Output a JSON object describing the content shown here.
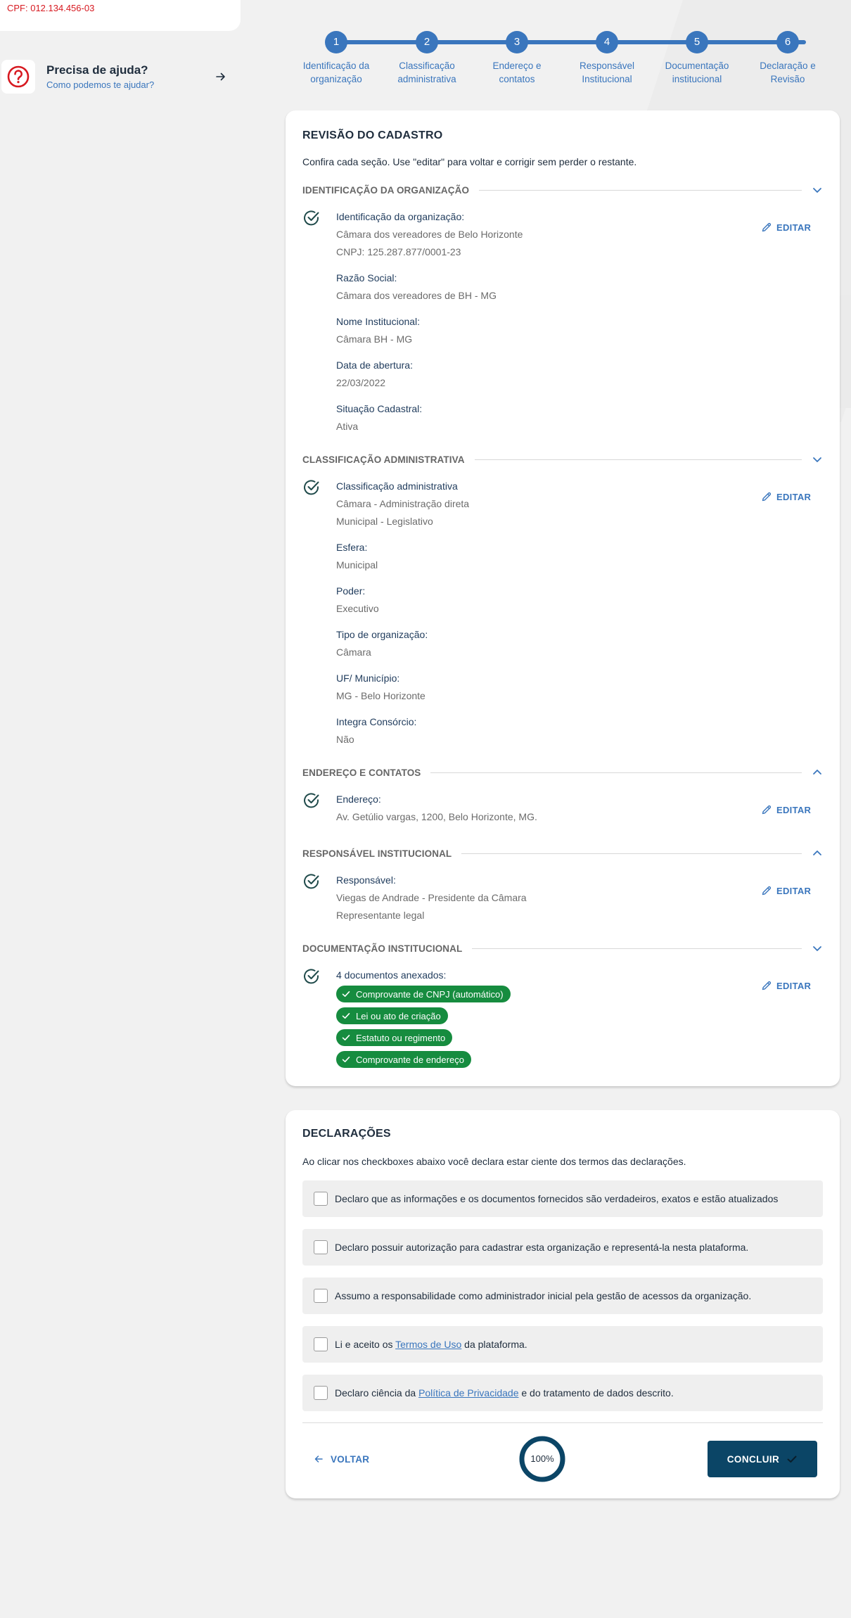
{
  "user": {
    "cpf": "CPF: 012.134.456-03"
  },
  "help": {
    "title": "Precisa de ajuda?",
    "subtitle": "Como podemos te ajudar?"
  },
  "stepper": {
    "steps": [
      {
        "number": "1",
        "label_line1": "Identificação da",
        "label_line2": "organização"
      },
      {
        "number": "2",
        "label_line1": "Classificação",
        "label_line2": "administrativa"
      },
      {
        "number": "3",
        "label_line1": "Endereço e",
        "label_line2": "contatos"
      },
      {
        "number": "4",
        "label_line1": "Responsável",
        "label_line2": "Institucional"
      },
      {
        "number": "5",
        "label_line1": "Documentação",
        "label_line2": "institucional"
      },
      {
        "number": "6",
        "label_line1": "Declaração e",
        "label_line2": "Revisão"
      }
    ]
  },
  "review": {
    "title": "REVISÃO DO CADASTRO",
    "intro": "Confira cada seção. Use \"editar\" para voltar e corrigir sem perder o restante.",
    "edit_label": "EDITAR",
    "sections": [
      {
        "title": "IDENTIFICAÇÃO DA ORGANIZAÇÃO",
        "fields": [
          {
            "label": "Identificação da organização:",
            "values": [
              "Câmara dos vereadores de Belo Horizonte",
              "CNPJ: 125.287.877/0001-23"
            ]
          },
          {
            "label": "Razão Social:",
            "values": [
              "Câmara dos vereadores de BH - MG"
            ]
          },
          {
            "label": "Nome Institucional:",
            "values": [
              "Câmara BH - MG"
            ]
          },
          {
            "label": "Data de abertura:",
            "values": [
              "22/03/2022"
            ]
          },
          {
            "label": "Situação Cadastral:",
            "values": [
              "Ativa"
            ]
          }
        ]
      },
      {
        "title": "CLASSIFICAÇÃO ADMINISTRATIVA",
        "fields": [
          {
            "label": "Classificação administrativa",
            "values": [
              "Câmara - Administração direta",
              "Municipal - Legislativo"
            ]
          },
          {
            "label": "Esfera:",
            "values": [
              "Municipal"
            ]
          },
          {
            "label": "Poder:",
            "values": [
              "Executivo"
            ]
          },
          {
            "label": "Tipo de organização:",
            "values": [
              "Câmara"
            ]
          },
          {
            "label": "UF/ Município:",
            "values": [
              "MG - Belo Horizonte"
            ]
          },
          {
            "label": "Integra Consórcio:",
            "values": [
              "Não"
            ]
          }
        ]
      },
      {
        "title": "ENDEREÇO E CONTATOS",
        "fields": [
          {
            "label": "Endereço:",
            "values": [
              "Av. Getúlio vargas, 1200, Belo Horizonte, MG."
            ]
          }
        ]
      },
      {
        "title": "RESPONSÁVEL INSTITUCIONAL",
        "fields": [
          {
            "label": "Responsável:",
            "values": [
              "Viegas de Andrade - Presidente da Câmara",
              "Representante legal"
            ]
          }
        ]
      },
      {
        "title": "DOCUMENTAÇÃO INSTITUCIONAL",
        "fields": [
          {
            "label": "4 documentos anexados:",
            "values": []
          }
        ],
        "documents": [
          "Comprovante de CNPJ (automático)",
          "Lei ou ato de criação",
          "Estatuto ou regimento",
          "Comprovante de endereço"
        ]
      }
    ]
  },
  "declarations": {
    "title": "DECLARAÇÕES",
    "intro": "Ao clicar nos checkboxes abaixo você declara estar ciente dos termos das declarações.",
    "items": [
      {
        "text": "Declaro que as informações e os documentos fornecidos são verdadeiros, exatos e estão atualizados",
        "checked": false
      },
      {
        "text": "Declaro possuir autorização para cadastrar esta organização e representá-la nesta plataforma.",
        "checked": false
      },
      {
        "text": "Assumo a responsabilidade como administrador inicial pela gestão de acessos da organização.",
        "checked": false
      },
      {
        "before": "Li e aceito os ",
        "link": "Termos de Uso",
        "after": " da plataforma.",
        "checked": false
      },
      {
        "before": "Declaro ciência da ",
        "link": "Política de Privacidade",
        "after": " e do tratamento de dados descrito.",
        "checked": false
      }
    ]
  },
  "footer": {
    "back_label": "VOLTAR",
    "progress_text": "100%",
    "progress_value": 1.0,
    "conclude_label": "CONCLUIR"
  },
  "colors": {
    "primary": "#3a76bd",
    "dark": "#0b4566",
    "success": "#168c3f",
    "alert": "#d71920"
  }
}
